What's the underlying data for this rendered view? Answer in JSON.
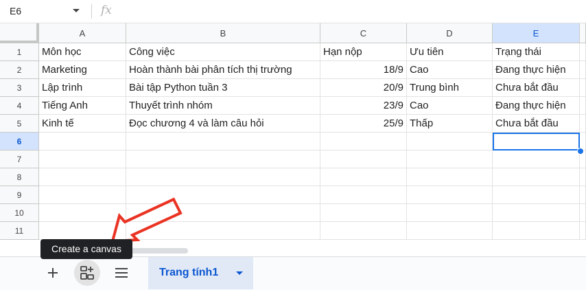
{
  "formula_bar": {
    "cell_ref": "E6",
    "fx": "fx"
  },
  "columns": [
    "A",
    "B",
    "C",
    "D",
    "E"
  ],
  "rows": [
    "1",
    "2",
    "3",
    "4",
    "5",
    "6",
    "7",
    "8",
    "9",
    "10",
    "11"
  ],
  "cells": [
    [
      "Môn học",
      "Công việc",
      "Hạn nộp",
      "Ưu tiên",
      "Trạng thái"
    ],
    [
      "Marketing",
      "Hoàn thành bài phân tích thị trường",
      "18/9",
      "Cao",
      "Đang thực hiện"
    ],
    [
      "Lập trình",
      "Bài tập Python tuần 3",
      "20/9",
      "Trung bình",
      "Chưa bắt đầu"
    ],
    [
      "Tiếng Anh",
      "Thuyết trình nhóm",
      "23/9",
      "Cao",
      "Đang thực hiện"
    ],
    [
      "Kinh tế",
      "Đọc chương 4 và làm câu hỏi",
      "25/9",
      "Thấp",
      "Chưa bắt đầu"
    ]
  ],
  "selected_cell": {
    "column": "E",
    "row": "6"
  },
  "tooltip": "Create a canvas",
  "sheet_tab": {
    "label": "Trang tính1"
  },
  "icons": {
    "add": "plus-icon",
    "canvas": "canvas-icon",
    "menu": "hamburger-icon",
    "dropdown": "caret-down-icon",
    "annotation": "red-arrow"
  },
  "colors": {
    "accent": "#0b57d0",
    "selection": "#1a73e8",
    "header_selected_bg": "#d3e3fd",
    "annotation_arrow": "#ea3323",
    "tooltip_bg": "#202124"
  }
}
